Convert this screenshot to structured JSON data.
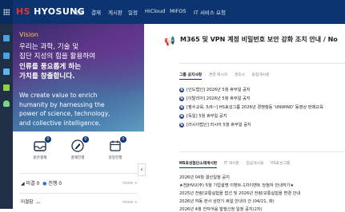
{
  "header": {
    "logo": "HYOSUNG",
    "nav": [
      "메일",
      "결재",
      "게시판",
      "일정",
      "HiCloud",
      "MIFOS",
      "IT 서비스 요청"
    ]
  },
  "vision": {
    "tag": "Vision",
    "ko_lines": [
      "우리는 과학, 기술 및",
      "집단 지성의 힘을 활용하여",
      "인류를 풍요롭게 하는",
      "가치를 창출합니다."
    ],
    "en_lines": [
      "We create value to enrich",
      "humanity by harnessing the",
      "power of science, technology,",
      "and collective intelligence."
    ]
  },
  "approval": {
    "items": [
      {
        "label": "받은결재",
        "count": "0"
      },
      {
        "label": "결재진행",
        "count": "0"
      },
      {
        "label": "일정진행",
        "count": "0"
      }
    ],
    "row1": {
      "left": "미결 0",
      "right": "진행 0",
      "more": "more +"
    },
    "row2": {
      "label": "미결함",
      "more": "more +"
    },
    "collapse": "‹"
  },
  "banner": {
    "text": "M365 및 VPN 계정 비밀번호 보안 강화 조치 안내 / No"
  },
  "notices": {
    "tabs": [
      "그룹 공지사항",
      "경영 메시지",
      "경조사",
      "통합게시판"
    ],
    "items": [
      "[인도법인] 2026년 5월 휴무일 공지",
      "[이탈리아] 2026년 5월 휴무일 공지",
      "[필수교육, 5/6~] HS효성그룹 2026년 경쟁행동 'UNWIND' 동영상 판매교육",
      "[독일] 5월 휴무일 공지",
      "[러시아법인] 러시아 5월 휴무일 공지"
    ]
  },
  "news": {
    "tabs": [
      "HS효성첨단소재게시판",
      "IT 게시판",
      "업금게시물",
      "HS효성그룹"
    ],
    "items": [
      "2026년 04월 결산일정 공지",
      "★전JHVU(주) 5월 기업설명 이벤트-1차이벤트 당첨자 안내하기★",
      "2025년 전량/교통실험을 접선 및 2026년 전량/교통실험을 변경 안내",
      "2026년 하동 본사 상반기 휴일 안내의 건 (04/21, 화)",
      "2026년 4월 전자어음 발행신청 일정 공지(2차)"
    ]
  }
}
